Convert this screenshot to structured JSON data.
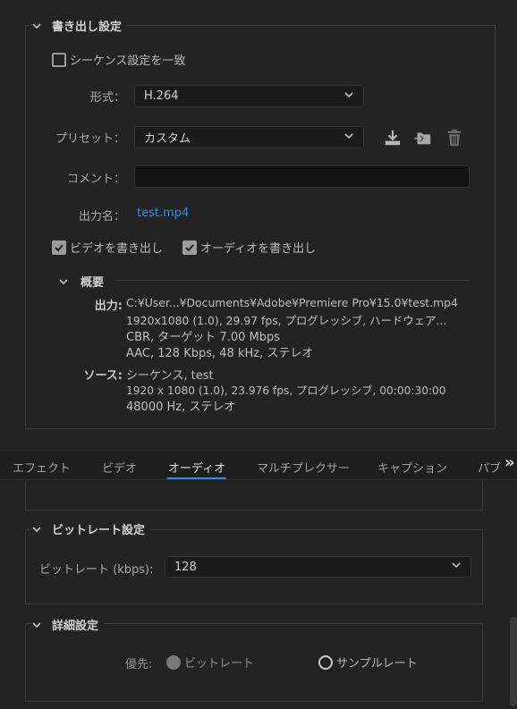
{
  "export_settings": {
    "title": "書き出し設定",
    "match_sequence": "シーケンス設定を一致",
    "format_label": "形式：",
    "format_value": "H.264",
    "preset_label": "プリセット：",
    "preset_value": "カスタム",
    "comment_label": "コメント：",
    "comment_value": "",
    "output_name_label": "出力名：",
    "output_name_value": "test.mp4",
    "export_video": "ビデオを書き出し",
    "export_audio": "オーディオを書き出し",
    "export_video_checked": true,
    "export_audio_checked": true,
    "match_sequence_checked": false
  },
  "summary": {
    "title": "概要",
    "output_label": "出力:",
    "output_lines": [
      "C:¥User...¥Documents¥Adobe¥Premiere Pro¥15.0¥test.mp4",
      "1920x1080 (1.0), 29.97 fps, プログレッシブ, ハードウェア...",
      "CBR, ターゲット 7.00 Mbps",
      "AAC, 128 Kbps, 48 kHz, ステレオ"
    ],
    "source_label": "ソース:",
    "source_lines": [
      "シーケンス, test",
      "1920 x 1080 (1.0), 23.976 fps, プログレッシブ, 00:00:30:00",
      "48000 Hz, ステレオ"
    ]
  },
  "tabs": [
    {
      "label": "エフェクト",
      "active": false
    },
    {
      "label": "ビデオ",
      "active": false
    },
    {
      "label": "オーディオ",
      "active": true
    },
    {
      "label": "マルチプレクサー",
      "active": false
    },
    {
      "label": "キャプション",
      "active": false
    },
    {
      "label": "パブ",
      "active": false
    }
  ],
  "tabs_overflow": "»",
  "bitrate_settings": {
    "title": "ビットレート設定",
    "bitrate_label": "ビットレート (kbps):",
    "bitrate_value": "128"
  },
  "advanced_settings": {
    "title": "詳細設定",
    "priority_label": "優先:",
    "option_bitrate": "ビットレート",
    "option_samplerate": "サンプルレート"
  },
  "colors": {
    "accent": "#2d8ceb",
    "link": "#2f8ee6",
    "background": "#232323"
  }
}
